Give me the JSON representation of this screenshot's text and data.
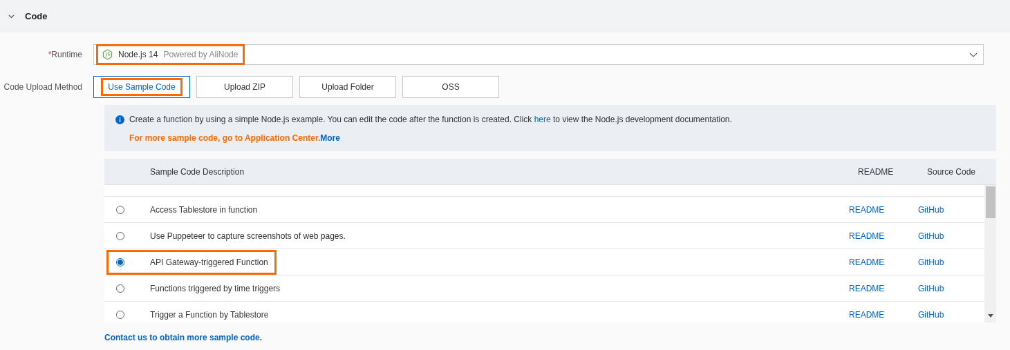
{
  "section": {
    "title": "Code",
    "expanded": true
  },
  "runtime": {
    "label": "Runtime",
    "required_mark": "*",
    "value": "Node.js 14",
    "note": "Powered by AliNode",
    "highlighted": true
  },
  "upload_method": {
    "label": "Code Upload Method",
    "options": [
      {
        "label": "Use Sample Code",
        "selected": true,
        "highlighted": true
      },
      {
        "label": "Upload ZIP",
        "selected": false,
        "highlighted": false
      },
      {
        "label": "Upload Folder",
        "selected": false,
        "highlighted": false
      },
      {
        "label": "OSS",
        "selected": false,
        "highlighted": false
      }
    ]
  },
  "info": {
    "before": "Create a function by using a simple Node.js example. You can edit the code after the function is created. Click ",
    "link": "here",
    "after": " to view the Node.js development documentation.",
    "promo": "For more sample code, go to Application Center.",
    "promo_link": "More"
  },
  "table": {
    "columns": [
      "Sample Code Description",
      "README",
      "Source Code"
    ],
    "rows": [
      {
        "description": "Access Tablestore in function",
        "readme": "README",
        "source": "GitHub",
        "selected": false,
        "highlighted": false
      },
      {
        "description": "Use Puppeteer to capture screenshots of web pages.",
        "readme": "README",
        "source": "GitHub",
        "selected": false,
        "highlighted": false
      },
      {
        "description": "API Gateway-triggered Function",
        "readme": "README",
        "source": "GitHub",
        "selected": true,
        "highlighted": true
      },
      {
        "description": "Functions triggered by time triggers",
        "readme": "README",
        "source": "GitHub",
        "selected": false,
        "highlighted": false
      },
      {
        "description": "Trigger a Function by Tablestore",
        "readme": "README",
        "source": "GitHub",
        "selected": false,
        "highlighted": false
      }
    ]
  },
  "footer_link": "Contact us to obtain more sample code."
}
